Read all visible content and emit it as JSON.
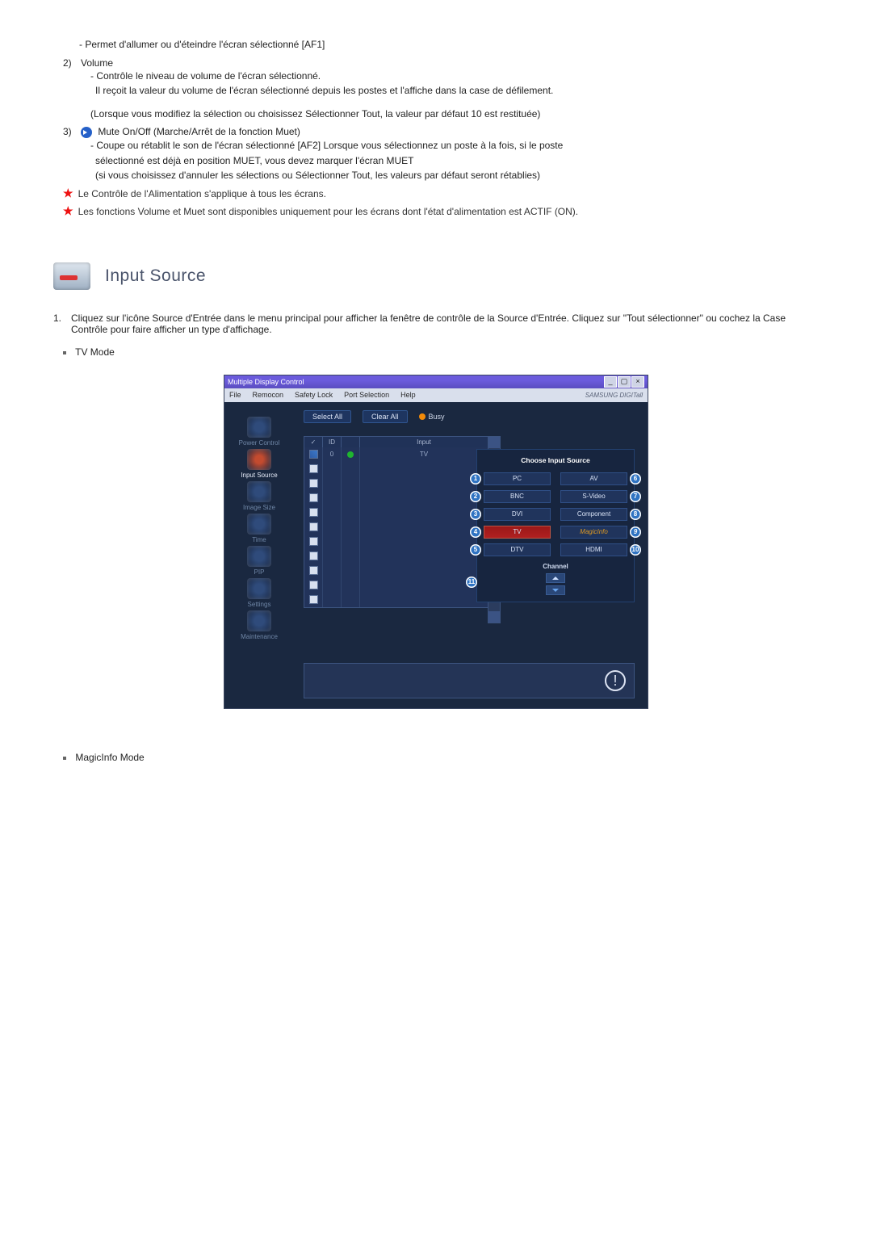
{
  "intro": {
    "power_line": "- Permet d'allumer ou d'éteindre l'écran sélectionné [AF1]",
    "volume_num": "2)",
    "volume_label": "Volume",
    "volume_l1": "- Contrôle le niveau de volume de l'écran sélectionné.",
    "volume_l2": "Il reçoit la valeur du volume de l'écran sélectionné depuis les postes et l'affiche dans la case de défilement.",
    "volume_l3": "(Lorsque vous modifiez la sélection ou choisissez Sélectionner Tout, la valeur par défaut 10 est restituée)",
    "mute_num": "3)",
    "mute_label": "Mute On/Off (Marche/Arrêt de la fonction Muet)",
    "mute_l1": "- Coupe ou rétablit le son de l'écran sélectionné [AF2] Lorsque vous sélectionnez un poste à la fois, si le poste",
    "mute_l1b": "sélectionné est déjà en position MUET, vous devez marquer l'écran MUET",
    "mute_l1c": "(si vous choisissez d'annuler les sélections ou Sélectionner Tout, les valeurs par défaut seront rétablies)",
    "star1": "Le Contrôle de l'Alimentation s'applique à tous les écrans.",
    "star2": "Les fonctions Volume et Muet sont disponibles uniquement pour les écrans dont l'état d'alimentation est ACTIF (ON)."
  },
  "section_title": "Input Source",
  "body": {
    "p1": "Cliquez sur l'icône Source d'Entrée dans le menu principal pour afficher la fenêtre de contrôle de la Source d'Entrée. Cliquez sur \"Tout sélectionner\" ou cochez la Case Contrôle pour faire afficher un type d'affichage.",
    "tv_mode": "TV Mode",
    "magic_mode": "MagicInfo Mode"
  },
  "app": {
    "title": "Multiple Display Control",
    "menu": [
      "File",
      "Remocon",
      "Safety Lock",
      "Port Selection",
      "Help"
    ],
    "brand": "SAMSUNG DIGITall",
    "toolbar": {
      "select_all": "Select All",
      "clear_all": "Clear All",
      "busy": "Busy"
    },
    "sidebar": [
      {
        "label": "Power Control",
        "selected": false
      },
      {
        "label": "Input Source",
        "selected": true
      },
      {
        "label": "Image Size",
        "selected": false
      },
      {
        "label": "Time",
        "selected": false
      },
      {
        "label": "PIP",
        "selected": false
      },
      {
        "label": "Settings",
        "selected": false
      },
      {
        "label": "Maintenance",
        "selected": false
      }
    ],
    "grid": {
      "headers": {
        "chk": "✓",
        "id": "ID",
        "led": "",
        "input": "Input"
      },
      "first_row": {
        "id": "0",
        "input": "TV"
      },
      "blank_rows": 10
    },
    "panel": {
      "title": "Choose Input Source",
      "left": [
        "PC",
        "BNC",
        "DVI",
        "TV",
        "DTV"
      ],
      "right": [
        "AV",
        "S-Video",
        "Component",
        "MagicInfo",
        "HDMI"
      ],
      "left_badges": [
        "1",
        "2",
        "3",
        "4",
        "5"
      ],
      "right_badges": [
        "6",
        "7",
        "8",
        "9",
        "10"
      ],
      "selected": "TV",
      "channel_title": "Channel",
      "channel_badge": "11"
    }
  }
}
